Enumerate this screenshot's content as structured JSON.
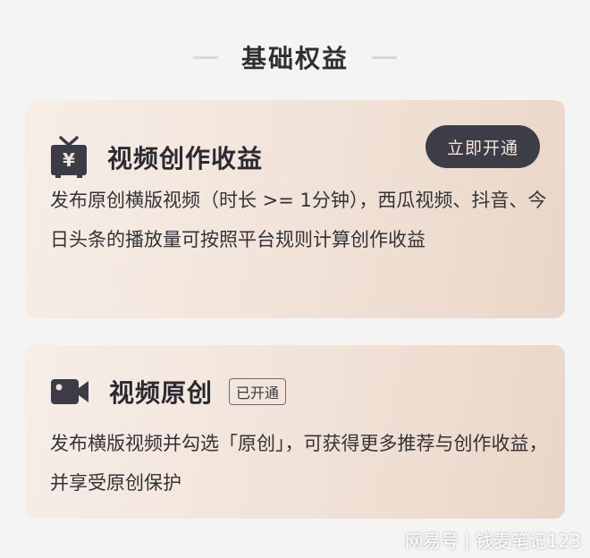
{
  "section": {
    "title": "基础权益"
  },
  "card_revenue": {
    "icon": "tv-yen-icon",
    "title": "视频创作收益",
    "button_label": "立即开通",
    "description": "发布原创横版视频（时长 >= 1分钟），西瓜视频、抖音、今日头条的播放量可按照平台规则计算创作收益"
  },
  "card_original": {
    "icon": "video-camera-icon",
    "title": "视频原创",
    "badge": "已开通",
    "description": "发布横版视频并勾选「原创」，可获得更多推荐与创作收益，并享受原创保护"
  },
  "watermark": {
    "source": "网易号",
    "separator": "|",
    "author": "钱麦笔记123"
  },
  "colors": {
    "button_bg": "#3d3d47",
    "button_text": "#f3e6d9",
    "card_bg": "#f1e2d7",
    "icon": "#3c3c46"
  }
}
